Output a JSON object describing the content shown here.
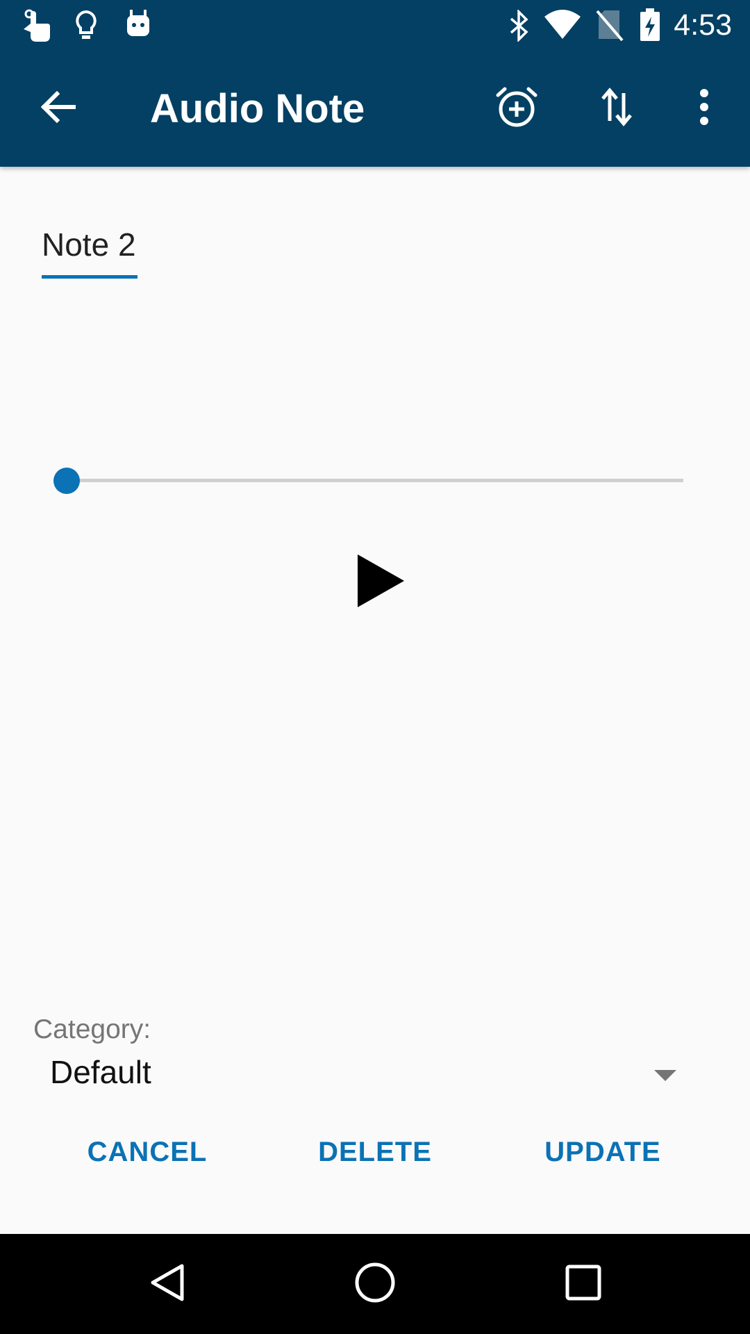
{
  "status_bar": {
    "time": "4:53",
    "left_icons": [
      "touch-notification-icon",
      "lightbulb-icon",
      "android-icon"
    ],
    "right_icons": [
      "bluetooth-icon",
      "wifi-icon",
      "no-sim-icon",
      "battery-charging-icon"
    ]
  },
  "toolbar": {
    "title": "Audio Note",
    "back_icon": "arrow-back-icon",
    "actions": [
      "alarm-add-icon",
      "swap-vertical-icon",
      "more-vert-icon"
    ]
  },
  "note": {
    "title": "Note 2"
  },
  "player": {
    "progress": 0,
    "play_icon": "play-icon"
  },
  "category": {
    "label": "Category:",
    "selected": "Default"
  },
  "actions": {
    "cancel": "CANCEL",
    "delete": "DELETE",
    "update": "UPDATE"
  },
  "colors": {
    "app_bar": "#034063",
    "accent": "#0a72b5",
    "background": "#fafafa"
  },
  "nav_bar": {
    "icons": [
      "back-triangle-icon",
      "home-circle-icon",
      "recents-square-icon"
    ]
  }
}
